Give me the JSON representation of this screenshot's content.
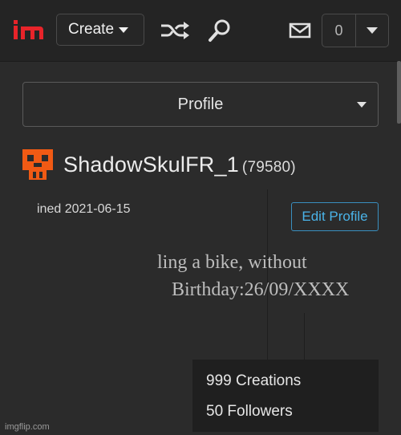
{
  "nav": {
    "create_label": "Create",
    "notification_count": "0"
  },
  "profile_select": {
    "label": "Profile"
  },
  "user": {
    "username": "ShadowSkulFR_1",
    "points": "(79580)",
    "joined": "ined 2021-06-15",
    "edit_label": "Edit Profile"
  },
  "bio": {
    "line1": "ling a bike, without",
    "line2": "Birthday:26/09/XXXX"
  },
  "stats": {
    "creations": "999 Creations",
    "followers": "50 Followers"
  },
  "footer": {
    "brand": "imgflip.com"
  },
  "colors": {
    "logo_red": "#e8242a",
    "avatar_orange": "#f05a14",
    "link_blue": "#4ab3e8"
  }
}
